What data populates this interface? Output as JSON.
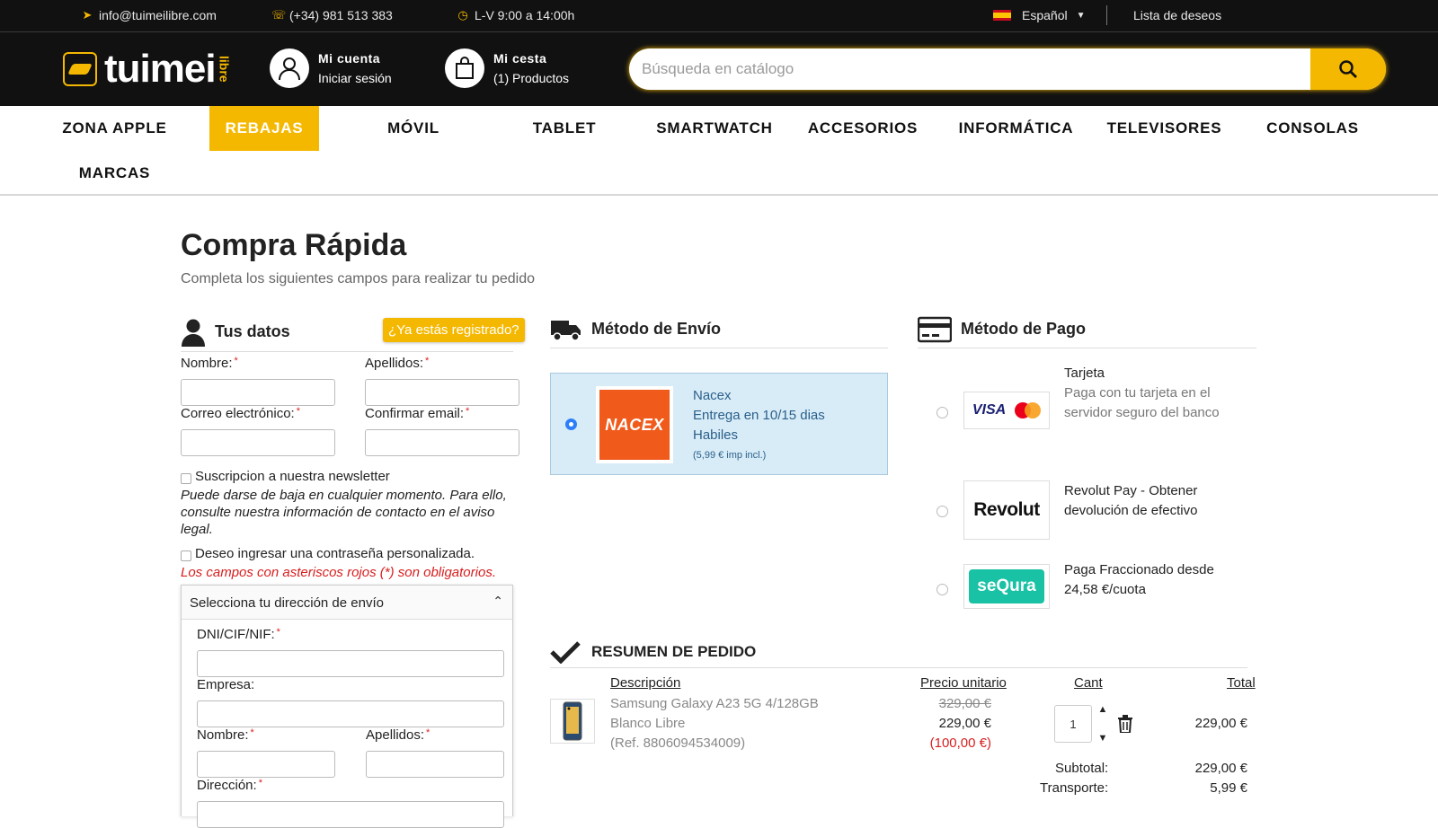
{
  "topbar": {
    "email": "info@tuimeilibre.com",
    "phone": "(+34) 981 513 383",
    "hours": "L-V 9:00 a 14:00h",
    "language": "Español",
    "wishlist": "Lista de deseos"
  },
  "header": {
    "logo_text": "tuimei",
    "logo_sub": "libre",
    "account_title": "Mi cuenta",
    "account_sub": "Iniciar sesión",
    "cart_title": "Mi cesta",
    "cart_sub": "(1) Productos",
    "search_placeholder": "Búsqueda en catálogo"
  },
  "nav": {
    "items": [
      "ZONA APPLE",
      "REBAJAS",
      "MÓVIL",
      "TABLET",
      "SMARTWATCH",
      "ACCESORIOS",
      "INFORMÁTICA",
      "TELEVISORES",
      "CONSOLAS",
      "MARCAS"
    ],
    "active": "REBAJAS"
  },
  "page": {
    "title": "Compra Rápida",
    "subtitle": "Completa los siguientes campos para realizar tu pedido"
  },
  "tus_datos": {
    "heading": "Tus datos",
    "registered_button": "¿Ya estás registrado?",
    "nombre_label": "Nombre:",
    "apellidos_label": "Apellidos:",
    "email_label": "Correo electrónico:",
    "confirm_email_label": "Confirmar email:",
    "newsletter_label": "Suscripcion a nuestra newsletter",
    "newsletter_note": "Puede darse de baja en cualquier momento. Para ello, consulte nuestra información de contacto en el aviso legal.",
    "password_label": "Deseo ingresar una contraseña personalizada.",
    "required_note": "Los campos con asteriscos rojos (*) son obligatorios.",
    "required_mark": "*"
  },
  "address": {
    "heading": "Selecciona tu dirección de envío",
    "dni_label": "DNI/CIF/NIF:",
    "empresa_label": "Empresa:",
    "nombre_label": "Nombre:",
    "apellidos_label": "Apellidos:",
    "direccion_label": "Dirección:"
  },
  "shipping": {
    "heading": "Método de Envío",
    "logo_text": "NACEX",
    "name": "Nacex",
    "delivery": "Entrega en 10/15 dias Habiles",
    "price": "(5,99 € imp incl.)",
    "selected": true
  },
  "payment": {
    "heading": "Método de Pago",
    "options": [
      {
        "title": "Tarjeta",
        "desc": "Paga con tu tarjeta en el servidor seguro del banco",
        "logo": "VISA"
      },
      {
        "title": "Revolut Pay - Obtener devolución de efectivo",
        "desc": "",
        "logo": "Revolut"
      },
      {
        "title": "Paga Fraccionado desde 24,58 €/cuota",
        "desc": "",
        "logo": "seQura"
      }
    ]
  },
  "summary": {
    "heading": "RESUMEN DE PEDIDO",
    "col_desc": "Descripción",
    "col_price": "Precio unitario",
    "col_qty": "Cant",
    "col_total": "Total",
    "product_name": "Samsung Galaxy A23 5G 4/128GB Blanco Libre",
    "product_ref": "(Ref. 8806094534009)",
    "old_price": "329,00 €",
    "price": "229,00 €",
    "discount": "(100,00 €)",
    "qty": "1",
    "line_total": "229,00 €",
    "subtotal_label": "Subtotal:",
    "subtotal": "229,00 €",
    "transport_label": "Transporte:",
    "transport": "5,99 €"
  },
  "colors": {
    "accent": "#f5b800",
    "dark": "#111111",
    "required": "#d81e1e"
  }
}
